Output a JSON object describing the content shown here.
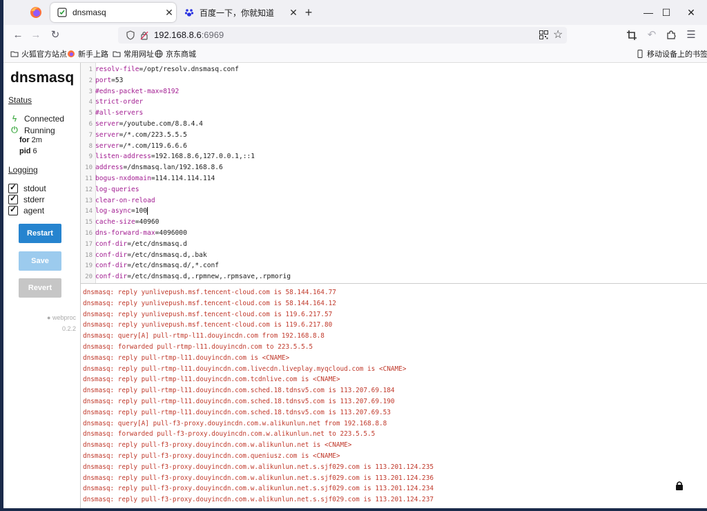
{
  "browser": {
    "tabs": [
      {
        "title": "dnsmasq",
        "active": true
      },
      {
        "title": "百度一下，你就知道",
        "active": false
      }
    ],
    "url_host": "192.168.8.6",
    "url_port": ":6969",
    "window_controls": {
      "minimize": "—",
      "maximize": "☐",
      "close": "✕"
    },
    "bookmarks": [
      {
        "label": "火狐官方站点",
        "icon": "folder-icon"
      },
      {
        "label": "新手上路",
        "icon": "firefox-icon"
      },
      {
        "label": "常用网址",
        "icon": "folder-icon"
      },
      {
        "label": "京东商城",
        "icon": "globe-icon"
      }
    ],
    "mobile_bookmarks": "移动设备上的书签"
  },
  "sidebar": {
    "brand": "dnsmasq",
    "status_heading": "Status",
    "connected": "Connected",
    "running": "Running",
    "for_label": "for",
    "for_value": "2m",
    "pid_label": "pid",
    "pid_value": "6",
    "logging_heading": "Logging",
    "streams": [
      "stdout",
      "stderr",
      "agent"
    ],
    "restart": "Restart",
    "save": "Save",
    "revert": "Revert",
    "footer_name": "webproc",
    "footer_version": "0.2.2"
  },
  "editor": {
    "lines": [
      {
        "n": "1",
        "k": "resolv-file",
        "v": "=/opt/resolv.dnsmasq.conf"
      },
      {
        "n": "2",
        "k": "port",
        "v": "=53"
      },
      {
        "n": "3",
        "k": "#edns-packet-max=8192",
        "v": ""
      },
      {
        "n": "4",
        "k": "strict-order",
        "v": ""
      },
      {
        "n": "5",
        "k": "#all-servers",
        "v": ""
      },
      {
        "n": "6",
        "k": "server",
        "v": "=/youtube.com/8.8.4.4"
      },
      {
        "n": "7",
        "k": "server",
        "v": "=/*.com/223.5.5.5"
      },
      {
        "n": "8",
        "k": "server",
        "v": "=/*.com/119.6.6.6"
      },
      {
        "n": "9",
        "k": "listen-address",
        "v": "=192.168.8.6,127.0.0.1,::1"
      },
      {
        "n": "10",
        "k": "address",
        "v": "=/dnsmasq.lan/192.168.8.6"
      },
      {
        "n": "11",
        "k": "bogus-nxdomain",
        "v": "=114.114.114.114"
      },
      {
        "n": "12",
        "k": "log-queries",
        "v": ""
      },
      {
        "n": "13",
        "k": "clear-on-reload",
        "v": ""
      },
      {
        "n": "14",
        "k": "log-async",
        "v": "=100"
      },
      {
        "n": "15",
        "k": "cache-size",
        "v": "=40960"
      },
      {
        "n": "16",
        "k": "dns-forward-max",
        "v": "=4096000"
      },
      {
        "n": "17",
        "k": "conf-dir",
        "v": "=/etc/dnsmasq.d"
      },
      {
        "n": "18",
        "k": "conf-dir",
        "v": "=/etc/dnsmasq.d,.bak"
      },
      {
        "n": "19",
        "k": "conf-dir",
        "v": "=/etc/dnsmasq.d/,*.conf"
      },
      {
        "n": "20",
        "k": "conf-dir",
        "v": "=/etc/dnsmasq.d,.rpmnew,.rpmsave,.rpmorig"
      }
    ]
  },
  "log": [
    "dnsmasq: reply yunlivepush.msf.tencent-cloud.com is 58.144.164.77",
    "dnsmasq: reply yunlivepush.msf.tencent-cloud.com is 58.144.164.12",
    "dnsmasq: reply yunlivepush.msf.tencent-cloud.com is 119.6.217.57",
    "dnsmasq: reply yunlivepush.msf.tencent-cloud.com is 119.6.217.80",
    "dnsmasq: query[A] pull-rtmp-l11.douyincdn.com from 192.168.8.8",
    "dnsmasq: forwarded pull-rtmp-l11.douyincdn.com to 223.5.5.5",
    "dnsmasq: reply pull-rtmp-l11.douyincdn.com is <CNAME>",
    "dnsmasq: reply pull-rtmp-l11.douyincdn.com.livecdn.liveplay.myqcloud.com is <CNAME>",
    "dnsmasq: reply pull-rtmp-l11.douyincdn.com.tcdnlive.com is <CNAME>",
    "dnsmasq: reply pull-rtmp-l11.douyincdn.com.sched.18.tdnsv5.com is 113.207.69.184",
    "dnsmasq: reply pull-rtmp-l11.douyincdn.com.sched.18.tdnsv5.com is 113.207.69.190",
    "dnsmasq: reply pull-rtmp-l11.douyincdn.com.sched.18.tdnsv5.com is 113.207.69.53",
    "dnsmasq: query[A] pull-f3-proxy.douyincdn.com.w.alikunlun.net from 192.168.8.8",
    "dnsmasq: forwarded pull-f3-proxy.douyincdn.com.w.alikunlun.net to 223.5.5.5",
    "dnsmasq: reply pull-f3-proxy.douyincdn.com.w.alikunlun.net is <CNAME>",
    "dnsmasq: reply pull-f3-proxy.douyincdn.com.queniusz.com is <CNAME>",
    "dnsmasq: reply pull-f3-proxy.douyincdn.com.w.alikunlun.net.s.sjf029.com is 113.201.124.235",
    "dnsmasq: reply pull-f3-proxy.douyincdn.com.w.alikunlun.net.s.sjf029.com is 113.201.124.236",
    "dnsmasq: reply pull-f3-proxy.douyincdn.com.w.alikunlun.net.s.sjf029.com is 113.201.124.234",
    "dnsmasq: reply pull-f3-proxy.douyincdn.com.w.alikunlun.net.s.sjf029.com is 113.201.124.237"
  ]
}
